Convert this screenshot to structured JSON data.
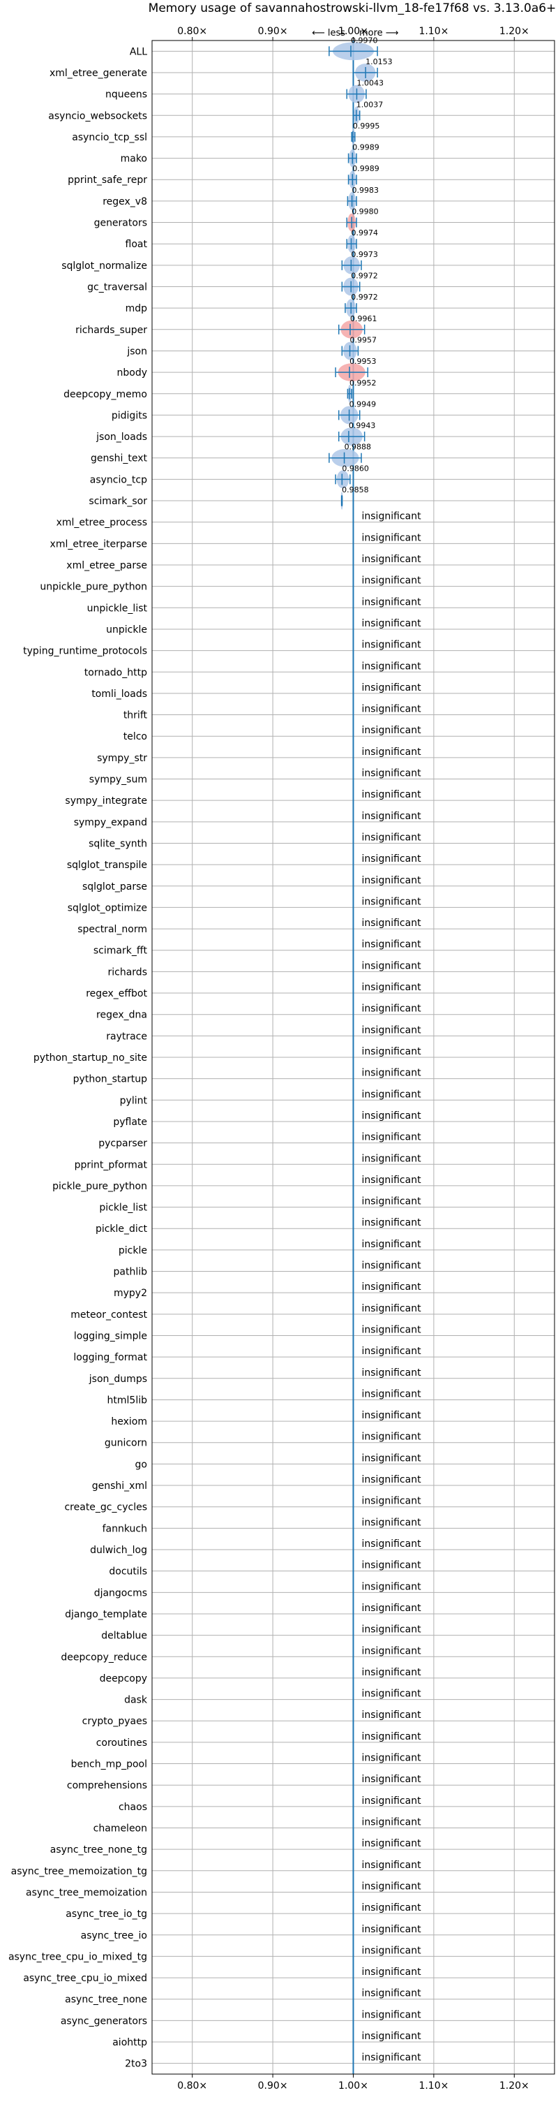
{
  "chart_data": {
    "type": "violin",
    "title": "Memory usage of savannahostrowski-llvm_18-fe17f68 vs. 3.13.0a6+",
    "xlim": [
      0.75,
      1.25
    ],
    "xticks": [
      0.8,
      0.9,
      1.0,
      1.1,
      1.2
    ],
    "xtick_labels": [
      "0.80×",
      "0.90×",
      "1.00×",
      "1.10×",
      "1.20×"
    ],
    "direction_labels": [
      "⟵ less",
      "more ⟶"
    ],
    "reference_line": 1.0,
    "grid": true,
    "insignificant_text": "insignificant",
    "colors": {
      "line": "#1f77b4",
      "violin": "#aec7e8",
      "violin_worse": "#f4a6a6",
      "grid": "#b0b0b0"
    },
    "rows": [
      {
        "name": "ALL",
        "value": 0.997,
        "label": "0.9970",
        "low": 0.97,
        "high": 1.03,
        "significant": true,
        "worse": false
      },
      {
        "name": "xml_etree_generate",
        "value": 1.0153,
        "label": "1.0153",
        "low": 1.0,
        "high": 1.03,
        "significant": true,
        "worse": false
      },
      {
        "name": "nqueens",
        "value": 1.0043,
        "label": "1.0043",
        "low": 0.992,
        "high": 1.016,
        "significant": true,
        "worse": false
      },
      {
        "name": "asyncio_websockets",
        "value": 1.0037,
        "label": "1.0037",
        "low": 1.0,
        "high": 1.008,
        "significant": true,
        "worse": false
      },
      {
        "name": "asyncio_tcp_ssl",
        "value": 0.9995,
        "label": "0.9995",
        "low": 0.998,
        "high": 1.002,
        "significant": true,
        "worse": false
      },
      {
        "name": "mako",
        "value": 0.9989,
        "label": "0.9989",
        "low": 0.994,
        "high": 1.004,
        "significant": true,
        "worse": false
      },
      {
        "name": "pprint_safe_repr",
        "value": 0.9989,
        "label": "0.9989",
        "low": 0.994,
        "high": 1.004,
        "significant": true,
        "worse": false
      },
      {
        "name": "regex_v8",
        "value": 0.9983,
        "label": "0.9983",
        "low": 0.993,
        "high": 1.004,
        "significant": true,
        "worse": false
      },
      {
        "name": "generators",
        "value": 0.998,
        "label": "0.9980",
        "low": 0.992,
        "high": 1.004,
        "significant": true,
        "worse": true
      },
      {
        "name": "float",
        "value": 0.9974,
        "label": "0.9974",
        "low": 0.992,
        "high": 1.004,
        "significant": true,
        "worse": false
      },
      {
        "name": "sqlglot_normalize",
        "value": 0.9973,
        "label": "0.9973",
        "low": 0.986,
        "high": 1.01,
        "significant": true,
        "worse": false
      },
      {
        "name": "gc_traversal",
        "value": 0.9972,
        "label": "0.9972",
        "low": 0.986,
        "high": 1.008,
        "significant": true,
        "worse": false
      },
      {
        "name": "mdp",
        "value": 0.9972,
        "label": "0.9972",
        "low": 0.99,
        "high": 1.004,
        "significant": true,
        "worse": false
      },
      {
        "name": "richards_super",
        "value": 0.9961,
        "label": "0.9961",
        "low": 0.982,
        "high": 1.014,
        "significant": true,
        "worse": true
      },
      {
        "name": "json",
        "value": 0.9957,
        "label": "0.9957",
        "low": 0.986,
        "high": 1.006,
        "significant": true,
        "worse": false
      },
      {
        "name": "nbody",
        "value": 0.9953,
        "label": "0.9953",
        "low": 0.978,
        "high": 1.018,
        "significant": true,
        "worse": true
      },
      {
        "name": "deepcopy_memo",
        "value": 0.9952,
        "label": "0.9952",
        "low": 0.993,
        "high": 0.998,
        "significant": true,
        "worse": false
      },
      {
        "name": "pidigits",
        "value": 0.9949,
        "label": "0.9949",
        "low": 0.982,
        "high": 1.008,
        "significant": true,
        "worse": false
      },
      {
        "name": "json_loads",
        "value": 0.9943,
        "label": "0.9943",
        "low": 0.982,
        "high": 1.014,
        "significant": true,
        "worse": false
      },
      {
        "name": "genshi_text",
        "value": 0.9888,
        "label": "0.9888",
        "low": 0.97,
        "high": 1.01,
        "significant": true,
        "worse": false
      },
      {
        "name": "asyncio_tcp",
        "value": 0.986,
        "label": "0.9860",
        "low": 0.978,
        "high": 0.996,
        "significant": true,
        "worse": false
      },
      {
        "name": "scimark_sor",
        "value": 0.9858,
        "label": "0.9858",
        "low": 0.9855,
        "high": 0.9861,
        "significant": true,
        "worse": false
      },
      {
        "name": "xml_etree_process",
        "significant": false
      },
      {
        "name": "xml_etree_iterparse",
        "significant": false
      },
      {
        "name": "xml_etree_parse",
        "significant": false
      },
      {
        "name": "unpickle_pure_python",
        "significant": false
      },
      {
        "name": "unpickle_list",
        "significant": false
      },
      {
        "name": "unpickle",
        "significant": false
      },
      {
        "name": "typing_runtime_protocols",
        "significant": false
      },
      {
        "name": "tornado_http",
        "significant": false
      },
      {
        "name": "tomli_loads",
        "significant": false
      },
      {
        "name": "thrift",
        "significant": false
      },
      {
        "name": "telco",
        "significant": false
      },
      {
        "name": "sympy_str",
        "significant": false
      },
      {
        "name": "sympy_sum",
        "significant": false
      },
      {
        "name": "sympy_integrate",
        "significant": false
      },
      {
        "name": "sympy_expand",
        "significant": false
      },
      {
        "name": "sqlite_synth",
        "significant": false
      },
      {
        "name": "sqlglot_transpile",
        "significant": false
      },
      {
        "name": "sqlglot_parse",
        "significant": false
      },
      {
        "name": "sqlglot_optimize",
        "significant": false
      },
      {
        "name": "spectral_norm",
        "significant": false
      },
      {
        "name": "scimark_fft",
        "significant": false
      },
      {
        "name": "richards",
        "significant": false
      },
      {
        "name": "regex_effbot",
        "significant": false
      },
      {
        "name": "regex_dna",
        "significant": false
      },
      {
        "name": "raytrace",
        "significant": false
      },
      {
        "name": "python_startup_no_site",
        "significant": false
      },
      {
        "name": "python_startup",
        "significant": false
      },
      {
        "name": "pylint",
        "significant": false
      },
      {
        "name": "pyflate",
        "significant": false
      },
      {
        "name": "pycparser",
        "significant": false
      },
      {
        "name": "pprint_pformat",
        "significant": false
      },
      {
        "name": "pickle_pure_python",
        "significant": false
      },
      {
        "name": "pickle_list",
        "significant": false
      },
      {
        "name": "pickle_dict",
        "significant": false
      },
      {
        "name": "pickle",
        "significant": false
      },
      {
        "name": "pathlib",
        "significant": false
      },
      {
        "name": "mypy2",
        "significant": false
      },
      {
        "name": "meteor_contest",
        "significant": false
      },
      {
        "name": "logging_simple",
        "significant": false
      },
      {
        "name": "logging_format",
        "significant": false
      },
      {
        "name": "json_dumps",
        "significant": false
      },
      {
        "name": "html5lib",
        "significant": false
      },
      {
        "name": "hexiom",
        "significant": false
      },
      {
        "name": "gunicorn",
        "significant": false
      },
      {
        "name": "go",
        "significant": false
      },
      {
        "name": "genshi_xml",
        "significant": false
      },
      {
        "name": "create_gc_cycles",
        "significant": false
      },
      {
        "name": "fannkuch",
        "significant": false
      },
      {
        "name": "dulwich_log",
        "significant": false
      },
      {
        "name": "docutils",
        "significant": false
      },
      {
        "name": "djangocms",
        "significant": false
      },
      {
        "name": "django_template",
        "significant": false
      },
      {
        "name": "deltablue",
        "significant": false
      },
      {
        "name": "deepcopy_reduce",
        "significant": false
      },
      {
        "name": "deepcopy",
        "significant": false
      },
      {
        "name": "dask",
        "significant": false
      },
      {
        "name": "crypto_pyaes",
        "significant": false
      },
      {
        "name": "coroutines",
        "significant": false
      },
      {
        "name": "bench_mp_pool",
        "significant": false
      },
      {
        "name": "comprehensions",
        "significant": false
      },
      {
        "name": "chaos",
        "significant": false
      },
      {
        "name": "chameleon",
        "significant": false
      },
      {
        "name": "async_tree_none_tg",
        "significant": false
      },
      {
        "name": "async_tree_memoization_tg",
        "significant": false
      },
      {
        "name": "async_tree_memoization",
        "significant": false
      },
      {
        "name": "async_tree_io_tg",
        "significant": false
      },
      {
        "name": "async_tree_io",
        "significant": false
      },
      {
        "name": "async_tree_cpu_io_mixed_tg",
        "significant": false
      },
      {
        "name": "async_tree_cpu_io_mixed",
        "significant": false
      },
      {
        "name": "async_tree_none",
        "significant": false
      },
      {
        "name": "async_generators",
        "significant": false
      },
      {
        "name": "aiohttp",
        "significant": false
      },
      {
        "name": "2to3",
        "significant": false
      }
    ]
  }
}
